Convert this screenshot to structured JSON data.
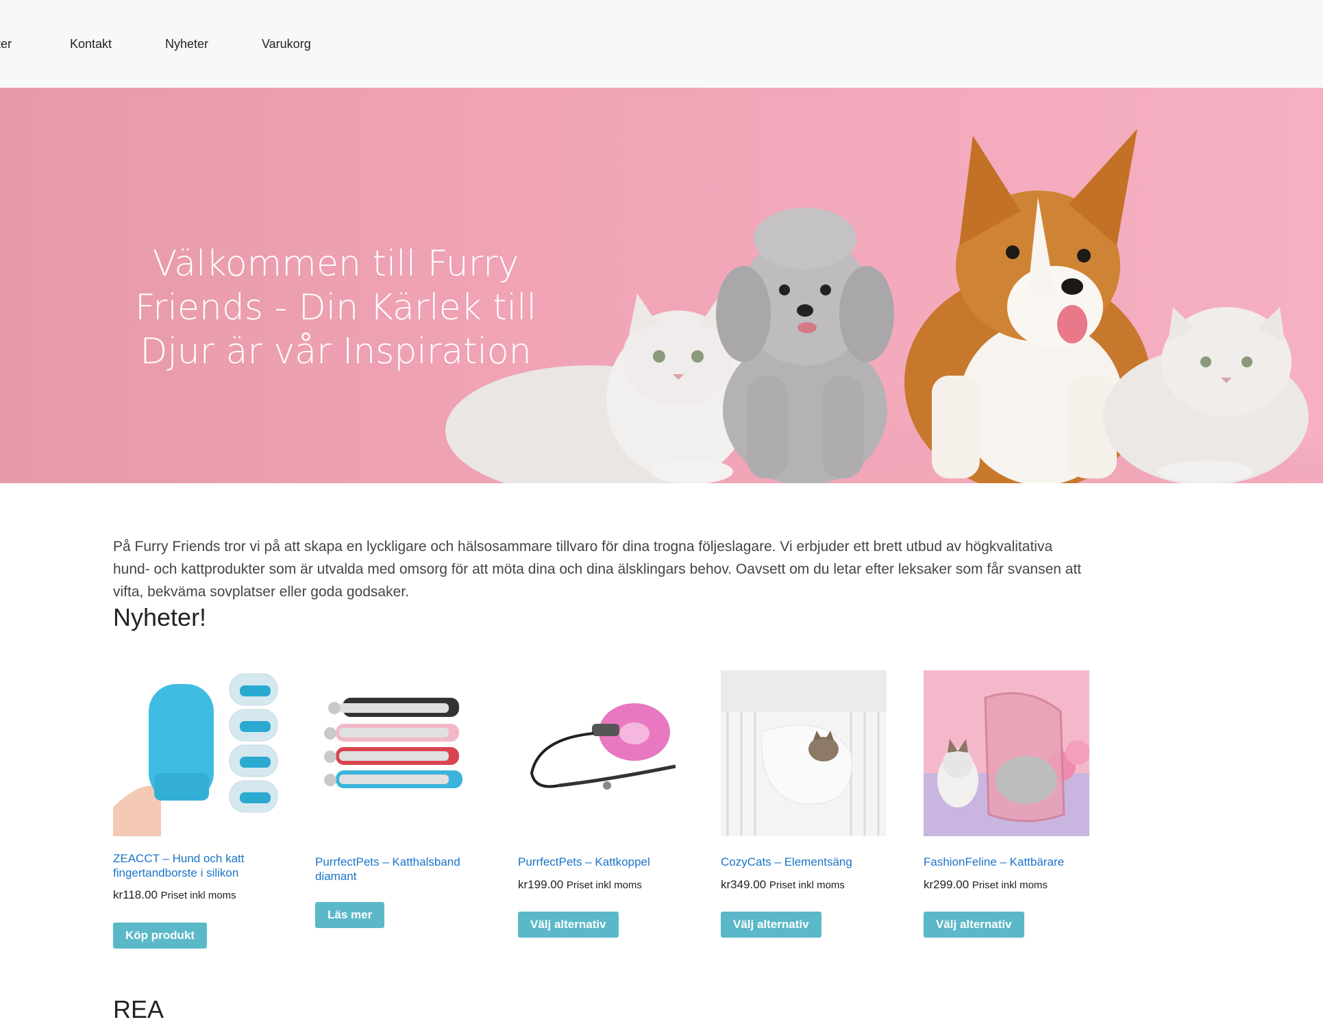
{
  "nav": {
    "items": [
      {
        "label": "ter"
      },
      {
        "label": "Kontakt"
      },
      {
        "label": "Nyheter"
      },
      {
        "label": "Varukorg"
      }
    ]
  },
  "hero": {
    "title": "Välkommen till Furry Friends - Din Kärlek till Djur är vår Inspiration"
  },
  "intro": {
    "text": "På Furry Friends tror vi på att skapa en lyckligare och hälsosammare tillvaro för dina trogna följeslagare. Vi erbjuder ett brett utbud av högkvalitativa hund- och kattprodukter som är utvalda med omsorg för att möta dina och dina älsklingars behov. Oavsett om du letar efter leksaker som får svansen att vifta, bekväma sovplatser eller goda godsaker."
  },
  "news": {
    "title": "Nyheter!",
    "products": [
      {
        "name": "ZEACCT – Hund och katt fingertandborste i silikon",
        "price": "kr118.00",
        "price_note": "Priset inkl moms",
        "button": "Köp produkt"
      },
      {
        "name": "PurrfectPets – Katthalsband diamant",
        "price": "",
        "price_note": "",
        "button": "Läs mer"
      },
      {
        "name": "PurrfectPets – Kattkoppel",
        "price": "kr199.00",
        "price_note": "Priset inkl moms",
        "button": "Välj alternativ"
      },
      {
        "name": "CozyCats – Elementsäng",
        "price": "kr349.00",
        "price_note": "Priset inkl moms",
        "button": "Välj alternativ"
      },
      {
        "name": "FashionFeline – Kattbärare",
        "price": "kr299.00",
        "price_note": "Priset inkl moms",
        "button": "Välj alternativ"
      }
    ]
  },
  "sale": {
    "title": "REA"
  },
  "colors": {
    "accent_button": "#5bb8c8",
    "link": "#1a73c8",
    "hero_bg": "#f0a4b6",
    "navbar_bg": "#f7f8fa"
  }
}
